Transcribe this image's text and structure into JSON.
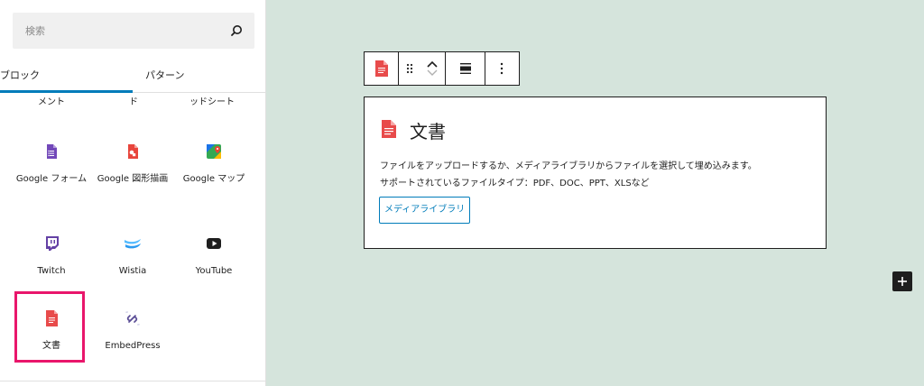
{
  "sidebar": {
    "search": {
      "placeholder": "検索"
    },
    "tabs": [
      {
        "label": "ブロック"
      },
      {
        "label": "パターン"
      }
    ],
    "cut_labels": [
      "メント",
      "ド",
      "ッドシート"
    ],
    "blocks": [
      {
        "label": "Google フォーム",
        "icon": "google-forms-icon"
      },
      {
        "label": "Google 図形描画",
        "icon": "google-drawings-icon"
      },
      {
        "label": "Google マップ",
        "icon": "google-maps-icon"
      },
      {
        "label": "Twitch",
        "icon": "twitch-icon"
      },
      {
        "label": "Wistia",
        "icon": "wistia-icon"
      },
      {
        "label": "YouTube",
        "icon": "youtube-icon"
      },
      {
        "label": "文書",
        "icon": "document-icon"
      },
      {
        "label": "EmbedPress",
        "icon": "embedpress-icon"
      }
    ]
  },
  "editor": {
    "card": {
      "title": "文書",
      "description_line1": "ファイルをアップロードするか、メディアライブラリからファイルを選択して埋め込みます。",
      "description_line2": "サポートされているファイルタイプ：PDF、DOC、PPT、XLSなど",
      "media_button": "メディアライブラリ"
    }
  },
  "colors": {
    "accent": "#007cba",
    "highlight": "#e9166b",
    "canvas": "#d5e4dc"
  }
}
